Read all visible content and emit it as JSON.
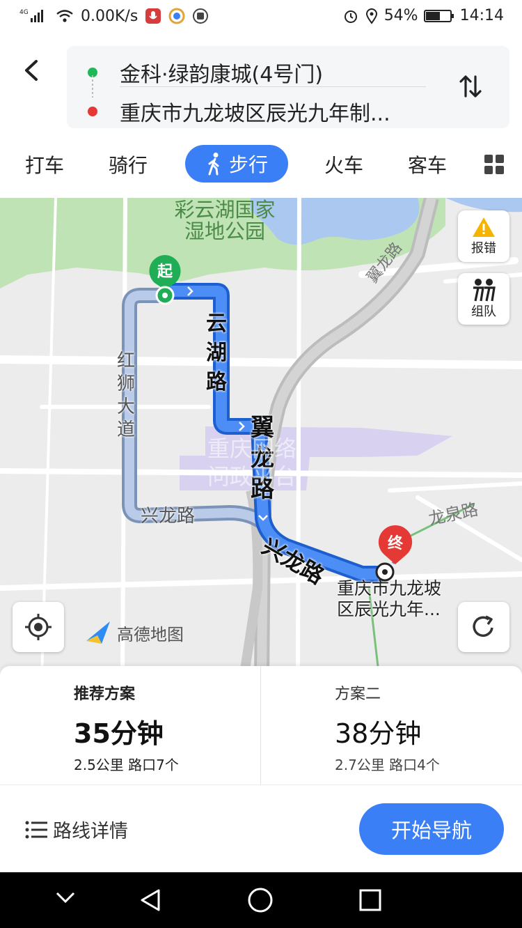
{
  "status_bar": {
    "network_type": "4G",
    "speed": "0.00K/s",
    "battery": "54%",
    "time": "14:14"
  },
  "route": {
    "origin": "金科·绿韵康城(4号门)",
    "destination": "重庆市九龙坡区辰光九年制..."
  },
  "modes": [
    "打车",
    "骑行",
    "步行",
    "火车",
    "客车"
  ],
  "active_mode": "步行",
  "map": {
    "labels": {
      "park": "彩云湖国家湿地公园",
      "park_line1": "彩云湖国家",
      "park_line2": "湿地公园",
      "road_yilong_diag": "翼龙路",
      "road_yunhu": "云湖路",
      "road_hongshi": "红狮大道",
      "road_yilong": "翼龙路",
      "road_xinglong_left": "兴龙路",
      "road_xinglong_main": "兴龙路",
      "road_longquan": "龙泉路",
      "dest_label_line1": "重庆市九龙坡",
      "dest_label_line2": "区辰光九年...",
      "watermark_line1": "重庆网络",
      "watermark_line2": "问政平台",
      "brand": "高德地图"
    },
    "markers": {
      "start": "起",
      "end": "终"
    },
    "buttons": {
      "report": "报错",
      "team": "组队"
    }
  },
  "plans": [
    {
      "name": "推荐方案",
      "time": "35分钟",
      "meta": "2.5公里 路口7个"
    },
    {
      "name": "方案二",
      "time": "38分钟",
      "meta": "2.7公里 路口4个"
    }
  ],
  "actions": {
    "details": "路线详情",
    "start_nav": "开始导航"
  },
  "colors": {
    "accent": "#3b7ff6",
    "origin_dot": "#1db954",
    "dest_dot": "#e53935",
    "park": "#bfe3b4",
    "water": "#aac8f0"
  }
}
